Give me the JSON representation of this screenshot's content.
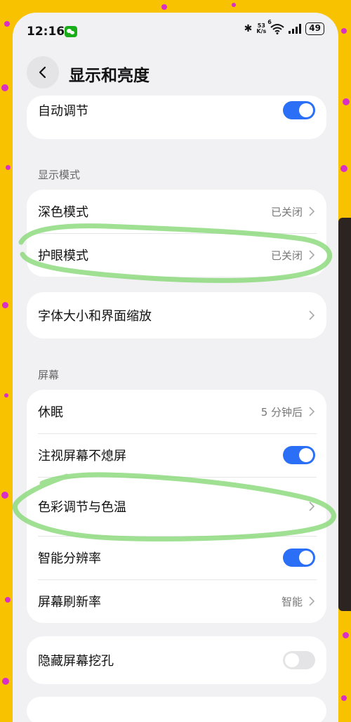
{
  "status_bar": {
    "time": "12:16",
    "network_speed_value": "53",
    "network_speed_unit": "K/s",
    "wifi_tag": "6",
    "battery": "49"
  },
  "header": {
    "title": "显示和亮度"
  },
  "auto_adjust": {
    "label": "自动调节",
    "enabled": true
  },
  "sections": {
    "display_mode": "显示模式",
    "screen": "屏幕"
  },
  "display_mode": {
    "dark_mode": {
      "label": "深色模式",
      "value": "已关闭"
    },
    "eye_care": {
      "label": "护眼模式",
      "value": "已关闭"
    }
  },
  "font_size": {
    "label": "字体大小和界面缩放"
  },
  "screen": {
    "sleep": {
      "label": "休眠",
      "value": "5 分钟后"
    },
    "gaze": {
      "label": "注视屏幕不熄屏",
      "enabled": true
    },
    "color": {
      "label": "色彩调节与色温"
    },
    "smart_resolution": {
      "label": "智能分辨率",
      "enabled": true
    },
    "refresh_rate": {
      "label": "屏幕刷新率",
      "value": "智能"
    }
  },
  "hide_punch_hole": {
    "label": "隐藏屏幕挖孔",
    "enabled": false
  },
  "colors": {
    "accent": "#2a6ff5",
    "frame": "#f8c200",
    "dots": "#d92fc6",
    "annotation": "#7fd66f"
  }
}
